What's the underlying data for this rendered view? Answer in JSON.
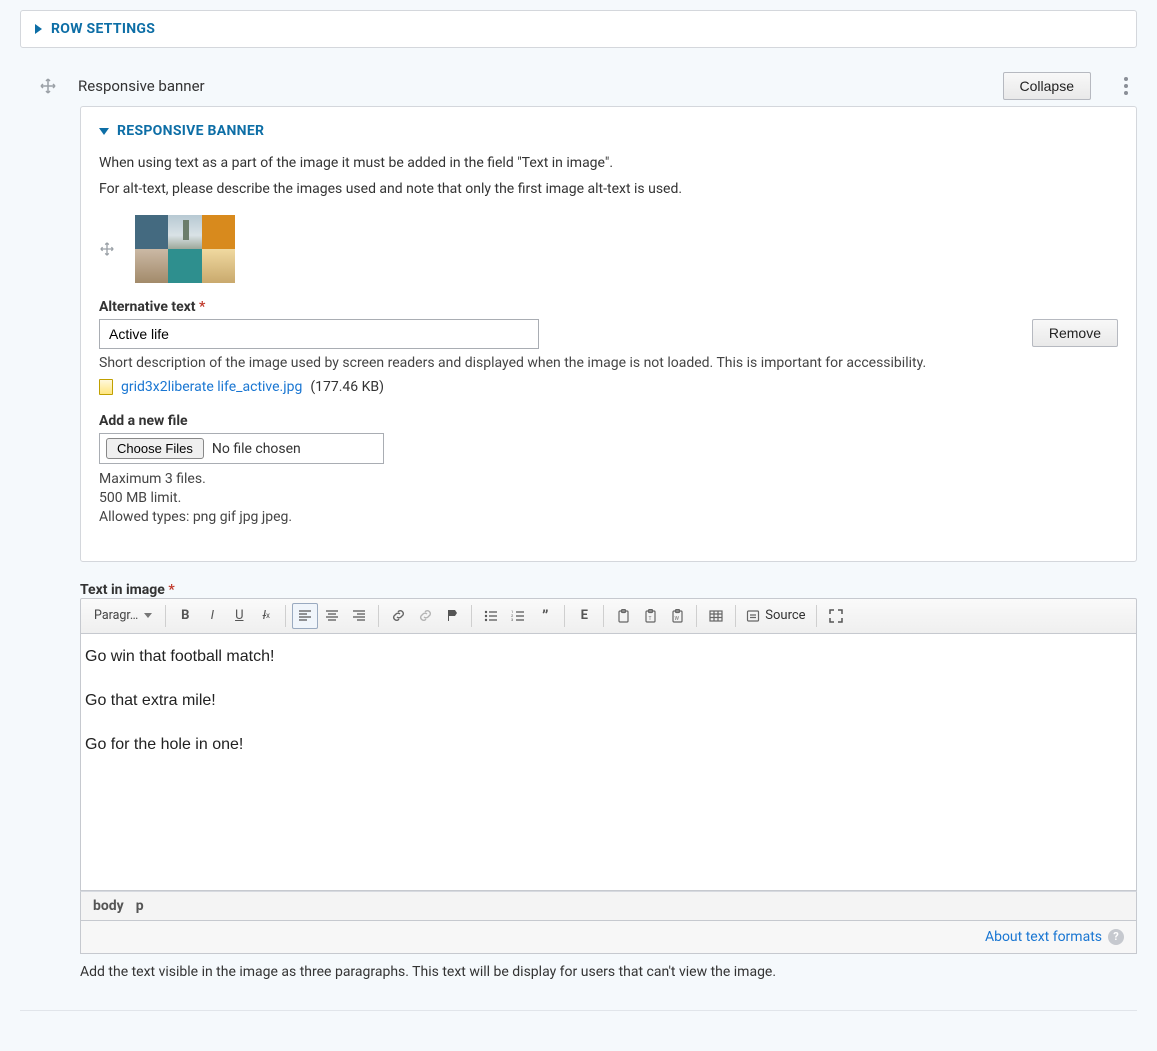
{
  "row_settings": {
    "title": "ROW SETTINGS"
  },
  "item": {
    "title": "Responsive banner",
    "collapse_label": "Collapse"
  },
  "panel": {
    "title": "RESPONSIVE BANNER",
    "desc1": "When using text as a part of the image it must be added in the field \"Text in image\".",
    "desc2": "For alt-text, please describe the images used and note that only the first image alt-text is used.",
    "remove_label": "Remove",
    "alt": {
      "label": "Alternative text",
      "value": "Active life",
      "help": "Short description of the image used by screen readers and displayed when the image is not loaded. This is important for accessibility."
    },
    "file": {
      "name": "grid3x2liberate life_active.jpg",
      "size": "(177.46 KB)"
    },
    "add_file": {
      "label": "Add a new file",
      "choose": "Choose Files",
      "no_file": "No file chosen",
      "hint1": "Maximum 3 files.",
      "hint2": "500 MB limit.",
      "hint3": "Allowed types: png gif jpg jpeg."
    }
  },
  "tii": {
    "label": "Text in image",
    "format_dd": "Paragr…",
    "source_label": "Source",
    "content": {
      "p1": "Go win that football match!",
      "p2": "Go that extra mile!",
      "p3": "Go for the hole in one!"
    },
    "path": {
      "a": "body",
      "b": "p"
    },
    "about": "About text formats",
    "bottom_help": "Add the text visible in the image as three paragraphs.  This text will be display for users that can't view the image."
  }
}
